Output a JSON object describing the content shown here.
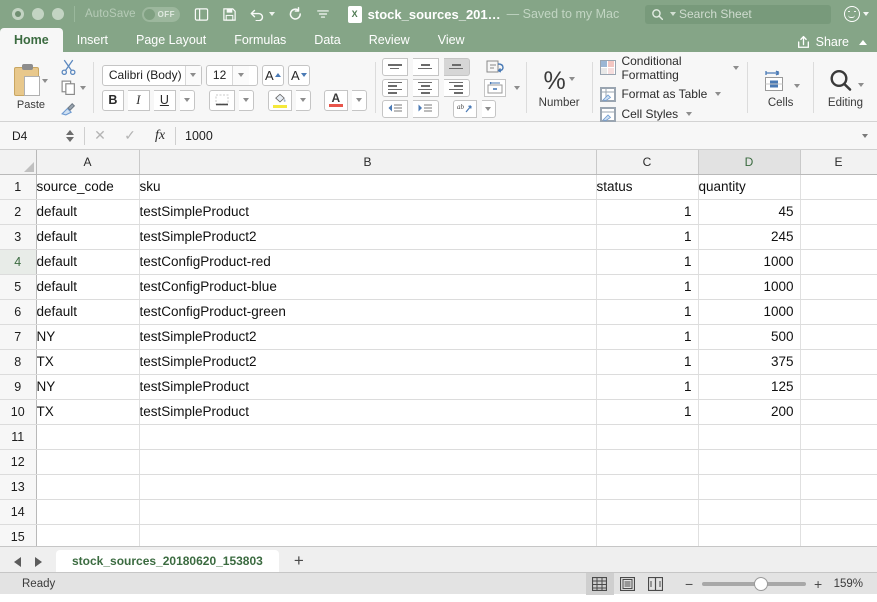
{
  "titlebar": {
    "autosave_label": "AutoSave",
    "autosave_state": "OFF",
    "doc_title": "stock_sources_201…",
    "saved_status": "— Saved to my Mac",
    "excel_badge": "X",
    "search_placeholder": "Search Sheet"
  },
  "tabs": [
    {
      "label": "Home",
      "active": true
    },
    {
      "label": "Insert",
      "active": false
    },
    {
      "label": "Page Layout",
      "active": false
    },
    {
      "label": "Formulas",
      "active": false
    },
    {
      "label": "Data",
      "active": false
    },
    {
      "label": "Review",
      "active": false
    },
    {
      "label": "View",
      "active": false
    }
  ],
  "share": {
    "label": "Share"
  },
  "ribbon": {
    "paste_label": "Paste",
    "font_name": "Calibri (Body)",
    "font_size": "12",
    "bold": "B",
    "italic": "I",
    "underline": "U",
    "number_symbol": "%",
    "number_label": "Number",
    "conditional_formatting": "Conditional Formatting",
    "format_as_table": "Format as Table",
    "cell_styles": "Cell Styles",
    "cells_label": "Cells",
    "editing_label": "Editing"
  },
  "formula_bar": {
    "name_box": "D4",
    "fx_label": "fx",
    "content": "1000"
  },
  "grid": {
    "columns": [
      "A",
      "B",
      "C",
      "D",
      "E"
    ],
    "selected_column": "D",
    "selected_row": 4,
    "rows": [
      {
        "n": "1",
        "a": "source_code",
        "b": "sku",
        "c": "status",
        "d": "quantity"
      },
      {
        "n": "2",
        "a": "default",
        "b": "testSimpleProduct",
        "c": "1",
        "d": "45"
      },
      {
        "n": "3",
        "a": "default",
        "b": "testSimpleProduct2",
        "c": "1",
        "d": "245"
      },
      {
        "n": "4",
        "a": "default",
        "b": "testConfigProduct-red",
        "c": "1",
        "d": "1000"
      },
      {
        "n": "5",
        "a": "default",
        "b": "testConfigProduct-blue",
        "c": "1",
        "d": "1000"
      },
      {
        "n": "6",
        "a": "default",
        "b": "testConfigProduct-green",
        "c": "1",
        "d": "1000"
      },
      {
        "n": "7",
        "a": "NY",
        "b": "testSimpleProduct2",
        "c": "1",
        "d": "500"
      },
      {
        "n": "8",
        "a": "TX",
        "b": "testSimpleProduct2",
        "c": "1",
        "d": "375"
      },
      {
        "n": "9",
        "a": "NY",
        "b": "testSimpleProduct",
        "c": "1",
        "d": "125"
      },
      {
        "n": "10",
        "a": "TX",
        "b": "testSimpleProduct",
        "c": "1",
        "d": "200"
      },
      {
        "n": "11",
        "a": "",
        "b": "",
        "c": "",
        "d": ""
      },
      {
        "n": "12",
        "a": "",
        "b": "",
        "c": "",
        "d": ""
      },
      {
        "n": "13",
        "a": "",
        "b": "",
        "c": "",
        "d": ""
      },
      {
        "n": "14",
        "a": "",
        "b": "",
        "c": "",
        "d": ""
      },
      {
        "n": "15",
        "a": "",
        "b": "",
        "c": "",
        "d": ""
      }
    ]
  },
  "sheetbar": {
    "sheet_name": "stock_sources_20180620_153803",
    "add_sheet": "+"
  },
  "statusbar": {
    "status": "Ready",
    "zoom_minus": "−",
    "zoom_plus": "+",
    "zoom_level": "159%"
  }
}
